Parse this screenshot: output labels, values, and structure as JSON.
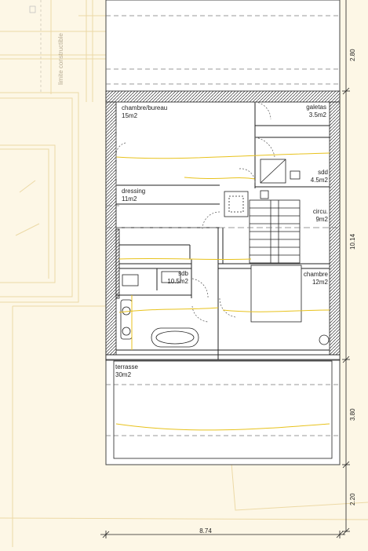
{
  "plan": {
    "limit_label": "limite constructible",
    "rooms": [
      {
        "id": "chambre-bureau",
        "name": "chambre/bureau",
        "area": "15m2"
      },
      {
        "id": "galetas",
        "name": "galetas",
        "area": "3.5m2"
      },
      {
        "id": "sdd",
        "name": "sdd",
        "area": "4.5m2"
      },
      {
        "id": "dressing",
        "name": "dressing",
        "area": "11m2"
      },
      {
        "id": "circu",
        "name": "circu.",
        "area": "9m2"
      },
      {
        "id": "sdb",
        "name": "sdb",
        "area": "10.5m2"
      },
      {
        "id": "chambre",
        "name": "chambre",
        "area": "12m2"
      },
      {
        "id": "terrasse",
        "name": "terrasse",
        "area": "30m2"
      }
    ],
    "dimensions": {
      "top": "2.80",
      "middle": "10.14",
      "lower": "3.80",
      "bottom_right": "2.20",
      "width": "8.74"
    },
    "colors": {
      "background": "#fdf7e6",
      "site_lines": "#ecd9a6",
      "plan_fill": "#ffffff",
      "wall": "#222222",
      "accent": "#e8c21c",
      "dashed": "#9a9a9a"
    }
  }
}
